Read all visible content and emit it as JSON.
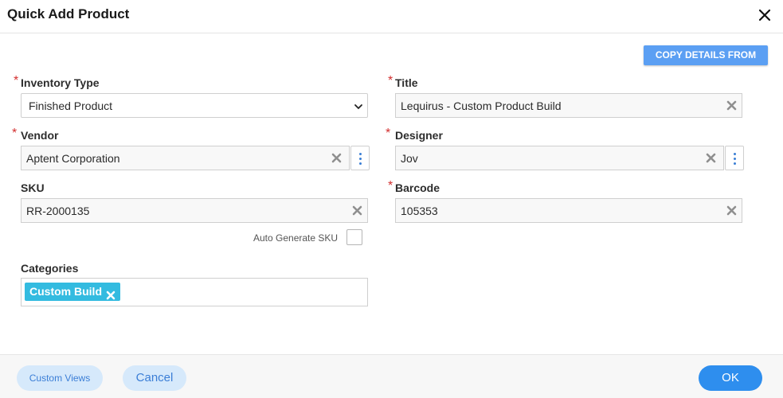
{
  "dialog": {
    "title": "Quick Add Product",
    "close_icon": "close-icon"
  },
  "toolbar": {
    "copy_details_label": "COPY DETAILS FROM"
  },
  "form": {
    "required_marker": "*",
    "inventory_type": {
      "label": "Inventory Type",
      "value": "Finished Product",
      "required": true
    },
    "title": {
      "label": "Title",
      "value": "Lequirus - Custom Product Build",
      "required": true
    },
    "vendor": {
      "label": "Vendor",
      "value": "Aptent Corporation",
      "required": true
    },
    "designer": {
      "label": "Designer",
      "value": "Jov",
      "required": true
    },
    "sku": {
      "label": "SKU",
      "value": "RR-2000135",
      "required": false
    },
    "barcode": {
      "label": "Barcode",
      "value": "105353",
      "required": true
    },
    "auto_generate_sku": {
      "label": "Auto Generate SKU",
      "checked": false
    },
    "categories": {
      "label": "Categories",
      "tags": [
        "Custom Build"
      ]
    }
  },
  "footer": {
    "custom_views_label": "Custom Views",
    "cancel_label": "Cancel",
    "ok_label": "OK"
  },
  "colors": {
    "primary": "#2e8eee",
    "copy_button": "#5b9ff3",
    "chip": "#33bbe0",
    "required": "#d32f2f",
    "soft_button": "#d6e9fb"
  }
}
